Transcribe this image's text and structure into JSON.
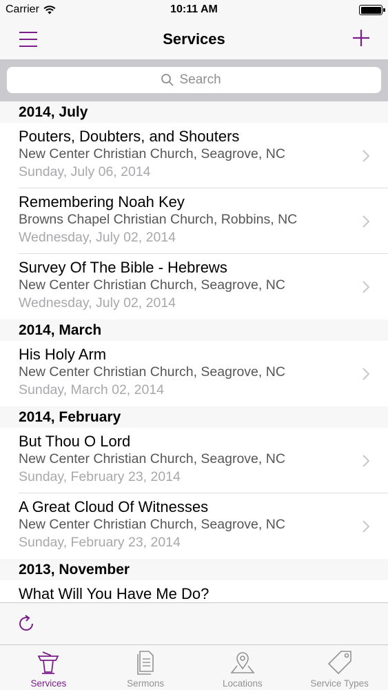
{
  "status_bar": {
    "carrier": "Carrier",
    "time": "10:11 AM"
  },
  "nav": {
    "title": "Services",
    "menu_icon": "hamburger-menu-icon",
    "add_icon": "plus-icon"
  },
  "search": {
    "placeholder": "Search"
  },
  "accent_color": "#7b1e8a",
  "sections": [
    {
      "header": "2014, July",
      "rows": [
        {
          "title": "Pouters, Doubters, and Shouters",
          "location": "New Center Christian Church, Seagrove, NC",
          "date": "Sunday, July 06, 2014"
        },
        {
          "title": "Remembering Noah Key",
          "location": "Browns Chapel Christian Church, Robbins, NC",
          "date": "Wednesday, July 02, 2014"
        },
        {
          "title": "Survey Of The Bible - Hebrews",
          "location": "New Center Christian Church, Seagrove, NC",
          "date": "Wednesday, July 02, 2014"
        }
      ]
    },
    {
      "header": "2014, March",
      "rows": [
        {
          "title": "His Holy Arm",
          "location": "New Center Christian Church, Seagrove, NC",
          "date": "Sunday, March 02, 2014"
        }
      ]
    },
    {
      "header": "2014, February",
      "rows": [
        {
          "title": "But Thou O Lord",
          "location": "New Center Christian Church, Seagrove, NC",
          "date": "Sunday, February 23, 2014"
        },
        {
          "title": "A Great Cloud Of Witnesses",
          "location": "New Center Christian Church, Seagrove, NC",
          "date": "Sunday, February 23, 2014"
        }
      ]
    },
    {
      "header": "2013, November",
      "rows": [
        {
          "title": "What Will You Have Me Do?"
        }
      ]
    }
  ],
  "toolbar": {
    "refresh_icon": "refresh-icon"
  },
  "tabs": [
    {
      "label": "Services",
      "icon": "podium-icon",
      "active": true
    },
    {
      "label": "Sermons",
      "icon": "document-icon",
      "active": false
    },
    {
      "label": "Locations",
      "icon": "map-pin-icon",
      "active": false
    },
    {
      "label": "Service Types",
      "icon": "tag-icon",
      "active": false
    }
  ]
}
